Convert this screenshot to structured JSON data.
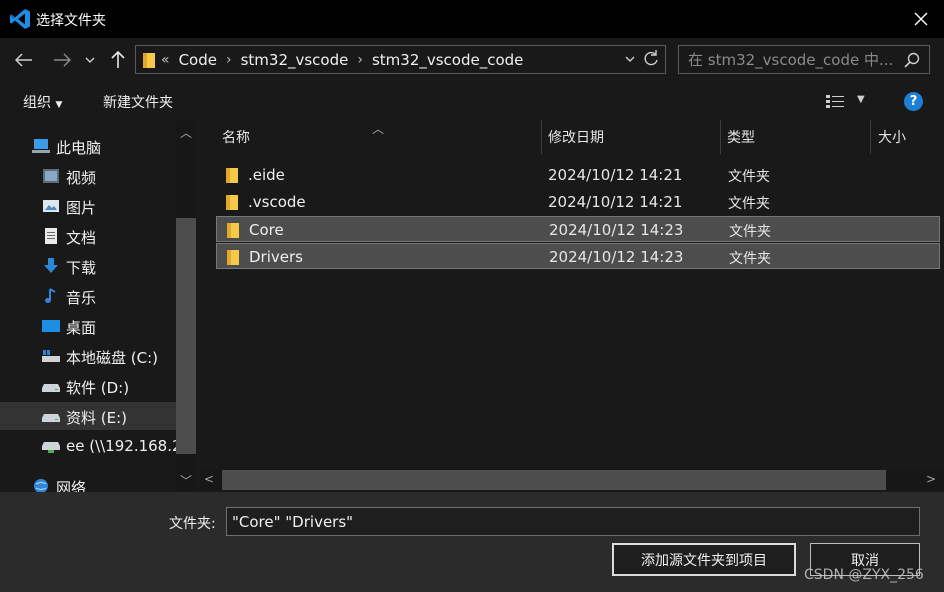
{
  "window": {
    "title": "选择文件夹"
  },
  "address": {
    "overflow": "«",
    "crumbs": [
      "Code",
      "stm32_vscode",
      "stm32_vscode_code"
    ]
  },
  "search": {
    "placeholder": "在 stm32_vscode_code 中..."
  },
  "toolbar": {
    "organize": "组织",
    "new_folder": "新建文件夹",
    "help": "?"
  },
  "sidebar": {
    "items": [
      {
        "label": "此电脑",
        "icon": "computer-icon"
      },
      {
        "label": "视频",
        "icon": "video-icon"
      },
      {
        "label": "图片",
        "icon": "pictures-icon"
      },
      {
        "label": "文档",
        "icon": "documents-icon"
      },
      {
        "label": "下载",
        "icon": "download-icon"
      },
      {
        "label": "音乐",
        "icon": "music-icon"
      },
      {
        "label": "桌面",
        "icon": "desktop-icon"
      },
      {
        "label": "本地磁盘 (C:)",
        "icon": "drive-c-icon"
      },
      {
        "label": "软件 (D:)",
        "icon": "drive-icon"
      },
      {
        "label": "资料 (E:)",
        "icon": "drive-icon"
      },
      {
        "label": "ee (\\\\192.168.2",
        "icon": "network-drive-icon"
      },
      {
        "label": "网络",
        "icon": "network-icon"
      }
    ]
  },
  "columns": {
    "name": "名称",
    "date": "修改日期",
    "type": "类型",
    "size": "大小"
  },
  "files": [
    {
      "name": ".eide",
      "date": "2024/10/12 14:21",
      "type": "文件夹"
    },
    {
      "name": ".vscode",
      "date": "2024/10/12 14:21",
      "type": "文件夹"
    },
    {
      "name": "Core",
      "date": "2024/10/12 14:23",
      "type": "文件夹"
    },
    {
      "name": "Drivers",
      "date": "2024/10/12 14:23",
      "type": "文件夹"
    }
  ],
  "footer": {
    "folder_label": "文件夹:",
    "folder_value": "\"Core\" \"Drivers\"",
    "ok_label": "添加源文件夹到项目",
    "cancel_label": "取消",
    "watermark": "CSDN @ZYX_256"
  },
  "colors": {
    "accent": "#1b7fd6",
    "folder": "#f7c948"
  }
}
